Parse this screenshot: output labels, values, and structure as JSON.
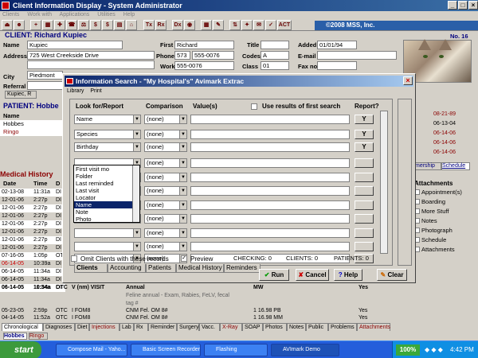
{
  "window": {
    "title": "Client Information Display - System Administrator"
  },
  "menu": [
    "Clients",
    "Work with",
    "Applications",
    "Utilities",
    "Help"
  ],
  "toolbar": {
    "icons": [
      "Tx",
      "Rx",
      "Dx",
      "ACT"
    ],
    "copyright": "©2008 MSS, Inc."
  },
  "client": {
    "header": "CLIENT:  Richard Kupiec",
    "name_label": "Name",
    "name": "Kupiec",
    "address_label": "Address",
    "address": "725 West Creekside Drive",
    "city_label": "City",
    "city": "Piedmont",
    "referral_label": "Referral",
    "first_label": "First",
    "first": "Richard",
    "phone_label": "Phone",
    "phone_area": "573",
    "phone": "555-0076",
    "work_label": "Work",
    "work": "555-0076",
    "title_label": "Title",
    "codes_label": "Codes",
    "codes": "A",
    "class_label": "Class",
    "class": "01",
    "added_label": "Added",
    "added": "01/01/94",
    "email_label": "E-mail",
    "fax_label": "Fax no.",
    "no_label": "No. 16",
    "tab": "Kupiec, R"
  },
  "patient": {
    "header": "PATIENT:  Hobbe",
    "name_col": "Name",
    "names": [
      "Hobbes",
      "Ringo"
    ]
  },
  "right_dates": [
    "08-21-89",
    "06-13-04",
    "06-14-06",
    "06-14-06",
    "06-14-06"
  ],
  "right_tabs": {
    "a": "mership",
    "b": "Schedule"
  },
  "attachments": {
    "title": "Attachments",
    "items": [
      "Appointment(s)",
      "Boarding",
      "More Stuff",
      "Notes",
      "Photograph",
      "Schedule",
      "Attachments"
    ]
  },
  "history": {
    "title": "Medical History",
    "cols": [
      "Date",
      "Time",
      "D"
    ],
    "rows": [
      {
        "date": "02-13-08",
        "time": "11:31a",
        "d": "DI"
      },
      {
        "date": "12-01-06",
        "time": "2:27p",
        "d": "DI"
      },
      {
        "date": "12-01-06",
        "time": "2:27p",
        "d": "DI"
      },
      {
        "date": "12-01-06",
        "time": "2:27p",
        "d": "DI"
      },
      {
        "date": "12-01-06",
        "time": "2:27p",
        "d": "DI"
      },
      {
        "date": "12-01-06",
        "time": "2:27p",
        "d": "DI"
      },
      {
        "date": "12-01-06",
        "time": "2:27p",
        "d": "DI"
      },
      {
        "date": "12-01-06",
        "time": "2:27p",
        "d": "DI"
      },
      {
        "date": "07-16-05",
        "time": "1:05p",
        "d": "OT"
      },
      {
        "date": "06-14-05",
        "time": "10:39a",
        "d": "DI"
      },
      {
        "date": "06-14-05",
        "time": "11:34a",
        "d": "DI"
      },
      {
        "date": "06-14-05",
        "time": "11:34a",
        "d": "DI"
      },
      {
        "date": "06-14-05",
        "time": "11:34a",
        "d": "DI"
      }
    ],
    "bottom": [
      {
        "date": "06-14-05",
        "time": "10:54a",
        "type": "OTC",
        "code": "V (nm) VISIT",
        "desc": "Annual",
        "flag": "MW",
        "val": "Yes"
      },
      {
        "date": "",
        "time": "",
        "type": "",
        "code": "",
        "desc": "Feline annual - Exam, Rabies, FeLV, fecal",
        "flag": "",
        "val": ""
      },
      {
        "date": "",
        "time": "",
        "type": "",
        "code": "",
        "desc": "tag #",
        "flag": "",
        "val": ""
      },
      {
        "date": "05-23-05",
        "time": "2:59p",
        "type": "OTC",
        "code": "I     FOM8",
        "desc": "CNM Fel. OM 8#",
        "flag": "1     16.98  PB",
        "val": "Yes"
      },
      {
        "date": "04-14-05",
        "time": "11:52a",
        "type": "OTC",
        "code": "I     FOM8",
        "desc": "CNM Fel. OM 8#",
        "flag": "1     16.98  MM",
        "val": "Yes"
      }
    ]
  },
  "bottom_tabs": [
    "Chronological",
    "Diagnoses",
    "Diet",
    "Injections",
    "Lab",
    "Rx",
    "Reminder",
    "Surgery",
    "Vacc.",
    "X-Ray",
    "SOAP",
    "Photos",
    "Notes",
    "Public",
    "Problems",
    "Attachments"
  ],
  "patient_tabs": [
    "Hobbes",
    "Ringo"
  ],
  "dialog": {
    "title": "Information Search - \"My Hospital's\" Avimark Extrac",
    "menu": [
      "Library",
      "Print"
    ],
    "col_look": "Look for/Report",
    "col_comp": "Comparison",
    "col_val": "Value(s)",
    "use_results": "Use results of first search",
    "col_report": "Report?",
    "rows": [
      {
        "field": "Name",
        "comp": "(none)",
        "report": "Y"
      },
      {
        "field": "Species",
        "comp": "(none)",
        "report": "Y"
      },
      {
        "field": "Birthday",
        "comp": "(none)",
        "report": "Y"
      },
      {
        "field": "",
        "comp": "(none)",
        "report": ""
      },
      {
        "field": "",
        "comp": "(none)",
        "report": ""
      },
      {
        "field": "",
        "comp": "(none)",
        "report": ""
      },
      {
        "field": "",
        "comp": "(none)",
        "report": ""
      },
      {
        "field": "",
        "comp": "(none)",
        "report": ""
      },
      {
        "field": "",
        "comp": "(none)",
        "report": ""
      },
      {
        "field": "",
        "comp": "(none)",
        "report": ""
      },
      {
        "field": "",
        "comp": "(none)",
        "report": ""
      }
    ],
    "dropdown": [
      "First visit mo",
      "Folder",
      "Last reminded",
      "Last visit",
      "Locator",
      "Name",
      "Note",
      "Photo"
    ],
    "dropdown_selected": 5,
    "omit": "Omit Clients with these records",
    "preview": "Preview",
    "checking": "CHECKING: 0",
    "clients": "CLIENTS: 0",
    "patients": "PATIENTS: 0",
    "tabs": [
      "Clients",
      "Accounting",
      "Patients",
      "Medical History",
      "Reminders"
    ],
    "run": "Run",
    "cancel": "Cancel",
    "help": "Help",
    "clear": "Clear"
  },
  "taskbar": {
    "start": "start",
    "tasks": [
      "Compose Mail - Yaho...",
      "Basic Screen Recorder",
      "Flashing",
      "AVImark Demo"
    ],
    "zoom": "100%",
    "clock": "4:42 PM"
  }
}
